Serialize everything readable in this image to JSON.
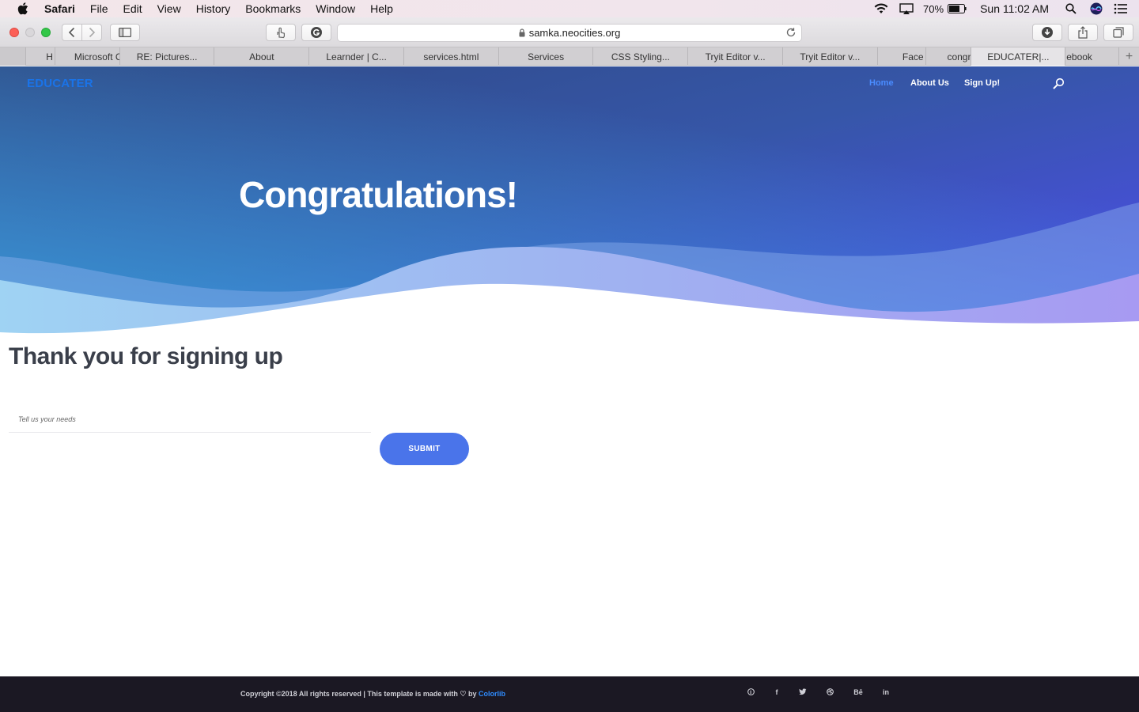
{
  "menubar": {
    "app": "Safari",
    "items": [
      "File",
      "Edit",
      "View",
      "History",
      "Bookmarks",
      "Window",
      "Help"
    ],
    "battery": "70%",
    "clock": "Sun 11:02 AM"
  },
  "browser": {
    "url": "samka.neocities.org",
    "tabs": [
      {
        "label": "H",
        "active": false
      },
      {
        "label": "Microsoft C",
        "active": false
      },
      {
        "label": "RE: Pictures...",
        "active": false
      },
      {
        "label": "About",
        "active": false
      },
      {
        "label": "Learnder | C...",
        "active": false
      },
      {
        "label": "services.html",
        "active": false
      },
      {
        "label": "Services",
        "active": false
      },
      {
        "label": "CSS Styling...",
        "active": false
      },
      {
        "label": "Tryit Editor v...",
        "active": false
      },
      {
        "label": "Tryit Editor v...",
        "active": false
      },
      {
        "label": "Face",
        "active": false
      },
      {
        "label": "congr",
        "active": false
      },
      {
        "label": "EDUCATER|...",
        "active": true
      },
      {
        "label": "ebook",
        "active": false
      },
      {
        "label": "+",
        "active": false
      }
    ]
  },
  "site": {
    "brand": "EDUCATER",
    "nav": {
      "home": "Home",
      "about": "About Us",
      "signup": "Sign Up!"
    },
    "hero_title": "Congratulations!",
    "thanks_heading": "Thank you for signing up",
    "needs_placeholder": "Tell us your needs",
    "submit_label": "SUBMIT"
  },
  "footer": {
    "copyright_text": "Copyright ©2018 All rights reserved | This template is made with ♡ by",
    "copyright_link": "Colorlib",
    "social": [
      "pinterest-icon",
      "facebook-icon",
      "twitter-icon",
      "dribbble-icon",
      "behance-icon",
      "linkedin-icon"
    ],
    "social_labels": {
      "behance": "Bē",
      "linkedin": "in",
      "facebook": "f"
    }
  },
  "colors": {
    "accent": "#1a73e8",
    "button": "#4a74ea",
    "footer_bg": "#1b1823",
    "hero_dark": "#2e3d7d",
    "hero_light": "#4b6de6"
  }
}
